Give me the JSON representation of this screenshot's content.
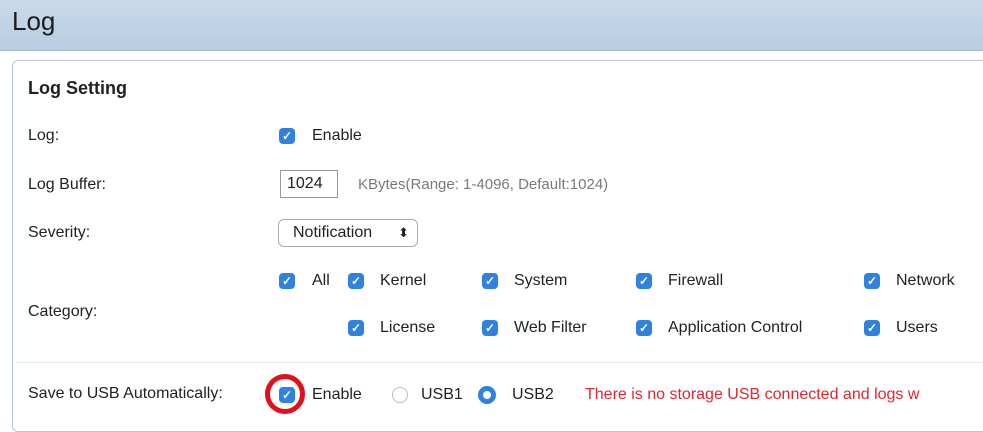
{
  "header": {
    "title": "Log"
  },
  "section": {
    "title": "Log Setting"
  },
  "log": {
    "label": "Log:",
    "enable_label": "Enable",
    "enabled": true
  },
  "buffer": {
    "label": "Log Buffer:",
    "value": "1024",
    "hint": "KBytes(Range: 1-4096, Default:1024)"
  },
  "severity": {
    "label": "Severity:",
    "selected": "Notification",
    "arrows": "⬍"
  },
  "category": {
    "label": "Category:",
    "items": [
      {
        "label": "All",
        "checked": true
      },
      {
        "label": "Kernel",
        "checked": true
      },
      {
        "label": "System",
        "checked": true
      },
      {
        "label": "Firewall",
        "checked": true
      },
      {
        "label": "Network",
        "checked": true
      },
      {
        "label": "License",
        "checked": true
      },
      {
        "label": "Web Filter",
        "checked": true
      },
      {
        "label": "Application Control",
        "checked": true
      },
      {
        "label": "Users",
        "checked": true
      }
    ]
  },
  "usb": {
    "label": "Save to USB Automatically:",
    "enable_label": "Enable",
    "enabled": true,
    "options": [
      "USB1",
      "USB2"
    ],
    "selected": "USB2",
    "warning": "There is no storage USB connected and logs w"
  },
  "colors": {
    "accent": "#2f82e0",
    "warning": "#e3252f",
    "highlight": "#e3101c",
    "header_bg": "#c9daea"
  }
}
